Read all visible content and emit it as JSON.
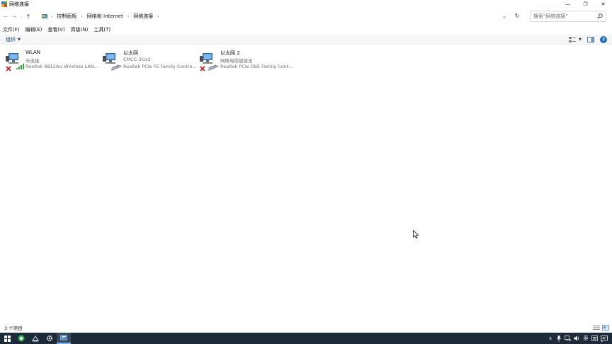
{
  "window": {
    "title": "网络连接",
    "controls": {
      "minimize": "—",
      "restore": "❐",
      "close": "✕"
    }
  },
  "navigation": {
    "back": "←",
    "forward": "→",
    "recent": "⌄",
    "up": "↑",
    "dropdown": "⌄",
    "refresh": "↻"
  },
  "breadcrumb": [
    {
      "label": "控制面板"
    },
    {
      "label": "网络和 Internet"
    },
    {
      "label": "网络连接"
    }
  ],
  "search": {
    "placeholder": "搜索\"网络连接\""
  },
  "menu": [
    "文件(F)",
    "编辑(E)",
    "查看(V)",
    "高级(N)",
    "工具(T)"
  ],
  "toolbar": {
    "organize_label": "组织",
    "organize_caret": "▼",
    "view_caret": "▼",
    "help": "?"
  },
  "adapters": [
    {
      "name": "WLAN",
      "status": "未连接",
      "device": "Realtek 8812AU Wireless LAN ...",
      "icon": "wireless-adapter-icon",
      "disconnected": true
    },
    {
      "name": "以太网",
      "status": "CMCC-3Gx2",
      "device": "Realtek PCIe FE Family Control...",
      "icon": "ethernet-adapter-icon",
      "disconnected": false
    },
    {
      "name": "以太网 2",
      "status": "网络电缆被拔出",
      "device": "Realtek PCIe GbE Family Contr...",
      "icon": "ethernet-adapter-icon",
      "disconnected": true
    }
  ],
  "statusbar": {
    "item_count": "3 个项目"
  },
  "taskbar": {
    "tray": {
      "chevron": "∧",
      "ime": "英"
    }
  },
  "colors": {
    "taskbar": "#1c2a3a",
    "accent": "#1f6fc5",
    "error_red": "#d21f1f",
    "secondary_text": "#6d6d6d"
  }
}
